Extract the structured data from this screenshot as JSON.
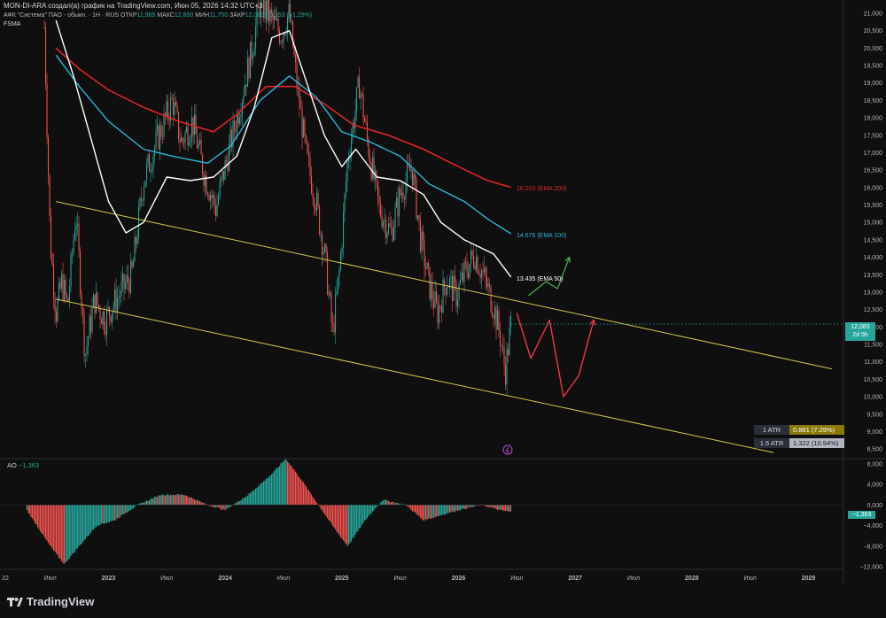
{
  "header": {
    "title": "MON-DI-ARA создал(а) график на TradingView.com, Июн 05, 2026 14:32 UTC+3",
    "symbol": "АФК \"Система\" ПАО - обыкн. · 1Н · RUS",
    "ohlc_open_label": "ОТКР",
    "ohlc_open": "11,985",
    "ohlc_high_label": "МАКС",
    "ohlc_high": "12,850",
    "ohlc_low_label": "МИН",
    "ohlc_low": "11,750",
    "ohlc_close_label": "ЗАКР",
    "ohlc_close": "12,083",
    "change": "+0,153 (+1,29%)",
    "ticker": "FSMA"
  },
  "ema_labels": {
    "ema200": "16.010 (EMA 200)",
    "ema100": "14.676 (EMA 100)",
    "ema50": "13.435 (EMA 50)"
  },
  "price_tag": {
    "value": "12,083",
    "sub": "2d 5h"
  },
  "atr": [
    {
      "label": "1 ATR",
      "value": "0.881 (7.29%)"
    },
    {
      "label": "1.5 ATR",
      "value": "1.322 (10.94%)"
    }
  ],
  "indicator": {
    "name": "AO",
    "value": "−1,363"
  },
  "brand": "TradingView",
  "colors": {
    "up": "#26a69a",
    "down": "#ef5350",
    "ema50": "#ffffff",
    "ema100": "#29b6d9",
    "ema200": "#e02424",
    "channel": "#d9c84a",
    "green_arrow": "#4caf50",
    "red_arrow": "#f23645"
  },
  "chart_data": {
    "type": "candlestick",
    "title": "АФК \"Система\" ПАО - обыкн. · 1Н · RUS",
    "price_axis": {
      "ticks": [
        "21,000",
        "20,500",
        "20,000",
        "19,500",
        "19,000",
        "18,500",
        "18,000",
        "17,500",
        "17,000",
        "16,500",
        "16,000",
        "15,500",
        "15,000",
        "14,500",
        "14,000",
        "13,500",
        "13,000",
        "12,500",
        "12,000",
        "11,500",
        "11,000",
        "10,500",
        "10,000",
        "9,500",
        "9,000",
        "8,500"
      ],
      "range": [
        8.3,
        21.0
      ]
    },
    "ao_axis": {
      "ticks": [
        "8,000",
        "4,000",
        "0,000",
        "−4,000",
        "−8,000",
        "−12,000"
      ],
      "range": [
        -12,
        9
      ]
    },
    "time_axis": [
      "22",
      "Июл",
      "2023",
      "Июл",
      "2024",
      "Июл",
      "2025",
      "Июл",
      "2026",
      "Июл",
      "2027",
      "Июл",
      "2028",
      "Июл",
      "2029"
    ],
    "price_path": [
      {
        "t": 2022.45,
        "p": 20.6
      },
      {
        "t": 2022.5,
        "p": 14.5
      },
      {
        "t": 2022.55,
        "p": 12.4
      },
      {
        "t": 2022.6,
        "p": 13.3
      },
      {
        "t": 2022.65,
        "p": 12.6
      },
      {
        "t": 2022.72,
        "p": 15.3
      },
      {
        "t": 2022.8,
        "p": 11.2
      },
      {
        "t": 2022.88,
        "p": 12.8
      },
      {
        "t": 2022.97,
        "p": 12.2
      },
      {
        "t": 2023.05,
        "p": 12.7
      },
      {
        "t": 2023.2,
        "p": 13.5
      },
      {
        "t": 2023.3,
        "p": 16.2
      },
      {
        "t": 2023.42,
        "p": 17.4
      },
      {
        "t": 2023.55,
        "p": 18.5
      },
      {
        "t": 2023.62,
        "p": 17.3
      },
      {
        "t": 2023.72,
        "p": 17.9
      },
      {
        "t": 2023.82,
        "p": 16.4
      },
      {
        "t": 2023.92,
        "p": 15.4
      },
      {
        "t": 2024.0,
        "p": 16.6
      },
      {
        "t": 2024.12,
        "p": 18.3
      },
      {
        "t": 2024.22,
        "p": 19.8
      },
      {
        "t": 2024.3,
        "p": 21.3
      },
      {
        "t": 2024.4,
        "p": 20.8
      },
      {
        "t": 2024.48,
        "p": 20.4
      },
      {
        "t": 2024.55,
        "p": 21.0
      },
      {
        "t": 2024.62,
        "p": 18.8
      },
      {
        "t": 2024.7,
        "p": 16.8
      },
      {
        "t": 2024.78,
        "p": 15.6
      },
      {
        "t": 2024.86,
        "p": 13.9
      },
      {
        "t": 2024.92,
        "p": 11.8
      },
      {
        "t": 2024.98,
        "p": 13.6
      },
      {
        "t": 2025.05,
        "p": 16.8
      },
      {
        "t": 2025.15,
        "p": 19.0
      },
      {
        "t": 2025.22,
        "p": 17.3
      },
      {
        "t": 2025.32,
        "p": 15.4
      },
      {
        "t": 2025.42,
        "p": 14.7
      },
      {
        "t": 2025.5,
        "p": 15.8
      },
      {
        "t": 2025.6,
        "p": 16.6
      },
      {
        "t": 2025.68,
        "p": 14.4
      },
      {
        "t": 2025.75,
        "p": 13.2
      },
      {
        "t": 2025.82,
        "p": 12.4
      },
      {
        "t": 2025.9,
        "p": 13.4
      },
      {
        "t": 2025.98,
        "p": 12.9
      },
      {
        "t": 2026.06,
        "p": 13.6
      },
      {
        "t": 2026.14,
        "p": 14.1
      },
      {
        "t": 2026.22,
        "p": 13.4
      },
      {
        "t": 2026.3,
        "p": 12.6
      },
      {
        "t": 2026.36,
        "p": 11.7
      },
      {
        "t": 2026.4,
        "p": 10.7
      },
      {
        "t": 2026.45,
        "p": 12.1
      }
    ],
    "ema200": [
      {
        "t": 2022.55,
        "p": 20.0
      },
      {
        "t": 2022.75,
        "p": 19.4
      },
      {
        "t": 2023.0,
        "p": 18.8
      },
      {
        "t": 2023.3,
        "p": 18.3
      },
      {
        "t": 2023.6,
        "p": 17.9
      },
      {
        "t": 2023.9,
        "p": 17.6
      },
      {
        "t": 2024.1,
        "p": 18.1
      },
      {
        "t": 2024.35,
        "p": 18.9
      },
      {
        "t": 2024.6,
        "p": 18.9
      },
      {
        "t": 2024.85,
        "p": 18.4
      },
      {
        "t": 2025.1,
        "p": 17.8
      },
      {
        "t": 2025.4,
        "p": 17.5
      },
      {
        "t": 2025.7,
        "p": 17.1
      },
      {
        "t": 2026.0,
        "p": 16.6
      },
      {
        "t": 2026.25,
        "p": 16.2
      },
      {
        "t": 2026.45,
        "p": 16.01
      }
    ],
    "ema100": [
      {
        "t": 2022.55,
        "p": 19.8
      },
      {
        "t": 2022.75,
        "p": 18.9
      },
      {
        "t": 2023.0,
        "p": 17.9
      },
      {
        "t": 2023.3,
        "p": 17.1
      },
      {
        "t": 2023.55,
        "p": 16.9
      },
      {
        "t": 2023.85,
        "p": 16.7
      },
      {
        "t": 2024.05,
        "p": 17.2
      },
      {
        "t": 2024.3,
        "p": 18.5
      },
      {
        "t": 2024.55,
        "p": 19.2
      },
      {
        "t": 2024.78,
        "p": 18.6
      },
      {
        "t": 2025.0,
        "p": 17.6
      },
      {
        "t": 2025.25,
        "p": 17.3
      },
      {
        "t": 2025.5,
        "p": 16.9
      },
      {
        "t": 2025.75,
        "p": 16.1
      },
      {
        "t": 2026.05,
        "p": 15.6
      },
      {
        "t": 2026.25,
        "p": 15.1
      },
      {
        "t": 2026.45,
        "p": 14.676
      }
    ],
    "ema50": [
      {
        "t": 2022.55,
        "p": 20.8
      },
      {
        "t": 2022.7,
        "p": 19.2
      },
      {
        "t": 2022.85,
        "p": 17.4
      },
      {
        "t": 2023.0,
        "p": 15.6
      },
      {
        "t": 2023.15,
        "p": 14.7
      },
      {
        "t": 2023.3,
        "p": 15.0
      },
      {
        "t": 2023.5,
        "p": 16.3
      },
      {
        "t": 2023.7,
        "p": 16.2
      },
      {
        "t": 2023.9,
        "p": 16.3
      },
      {
        "t": 2024.1,
        "p": 16.9
      },
      {
        "t": 2024.25,
        "p": 18.3
      },
      {
        "t": 2024.4,
        "p": 20.3
      },
      {
        "t": 2024.55,
        "p": 20.5
      },
      {
        "t": 2024.7,
        "p": 19.0
      },
      {
        "t": 2024.85,
        "p": 17.5
      },
      {
        "t": 2025.0,
        "p": 16.6
      },
      {
        "t": 2025.12,
        "p": 17.1
      },
      {
        "t": 2025.3,
        "p": 16.3
      },
      {
        "t": 2025.5,
        "p": 16.2
      },
      {
        "t": 2025.7,
        "p": 15.8
      },
      {
        "t": 2025.85,
        "p": 15.0
      },
      {
        "t": 2026.05,
        "p": 14.5
      },
      {
        "t": 2026.3,
        "p": 14.1
      },
      {
        "t": 2026.45,
        "p": 13.435
      }
    ],
    "channel_upper": [
      {
        "t": 2022.55,
        "p": 15.6
      },
      {
        "t": 2029.2,
        "p": 10.8
      }
    ],
    "channel_lower": [
      {
        "t": 2022.55,
        "p": 12.8
      },
      {
        "t": 2028.7,
        "p": 8.4
      }
    ],
    "projection_green": [
      {
        "t": 2026.6,
        "p": 12.9
      },
      {
        "t": 2026.75,
        "p": 13.3
      },
      {
        "t": 2026.85,
        "p": 13.1
      },
      {
        "t": 2026.95,
        "p": 14.0
      }
    ],
    "projection_red": [
      {
        "t": 2026.5,
        "p": 12.4
      },
      {
        "t": 2026.62,
        "p": 11.1
      },
      {
        "t": 2026.78,
        "p": 12.2
      },
      {
        "t": 2026.9,
        "p": 10.0
      },
      {
        "t": 2027.03,
        "p": 10.6
      },
      {
        "t": 2027.16,
        "p": 12.2
      }
    ],
    "ao_path": [
      {
        "t": 2022.3,
        "v": -1
      },
      {
        "t": 2022.5,
        "v": -8
      },
      {
        "t": 2022.62,
        "v": -11.5
      },
      {
        "t": 2022.75,
        "v": -8
      },
      {
        "t": 2022.9,
        "v": -4
      },
      {
        "t": 2023.05,
        "v": -3
      },
      {
        "t": 2023.25,
        "v": 0
      },
      {
        "t": 2023.45,
        "v": 2
      },
      {
        "t": 2023.65,
        "v": 2
      },
      {
        "t": 2023.85,
        "v": 0
      },
      {
        "t": 2024.0,
        "v": -1
      },
      {
        "t": 2024.2,
        "v": 2
      },
      {
        "t": 2024.4,
        "v": 6
      },
      {
        "t": 2024.52,
        "v": 9
      },
      {
        "t": 2024.65,
        "v": 5
      },
      {
        "t": 2024.8,
        "v": 0
      },
      {
        "t": 2024.95,
        "v": -5
      },
      {
        "t": 2025.05,
        "v": -8
      },
      {
        "t": 2025.2,
        "v": -3
      },
      {
        "t": 2025.35,
        "v": 1
      },
      {
        "t": 2025.55,
        "v": 0
      },
      {
        "t": 2025.7,
        "v": -3
      },
      {
        "t": 2025.85,
        "v": -2
      },
      {
        "t": 2026.0,
        "v": -1
      },
      {
        "t": 2026.2,
        "v": 0
      },
      {
        "t": 2026.35,
        "v": -1
      },
      {
        "t": 2026.45,
        "v": -1.363
      }
    ]
  }
}
